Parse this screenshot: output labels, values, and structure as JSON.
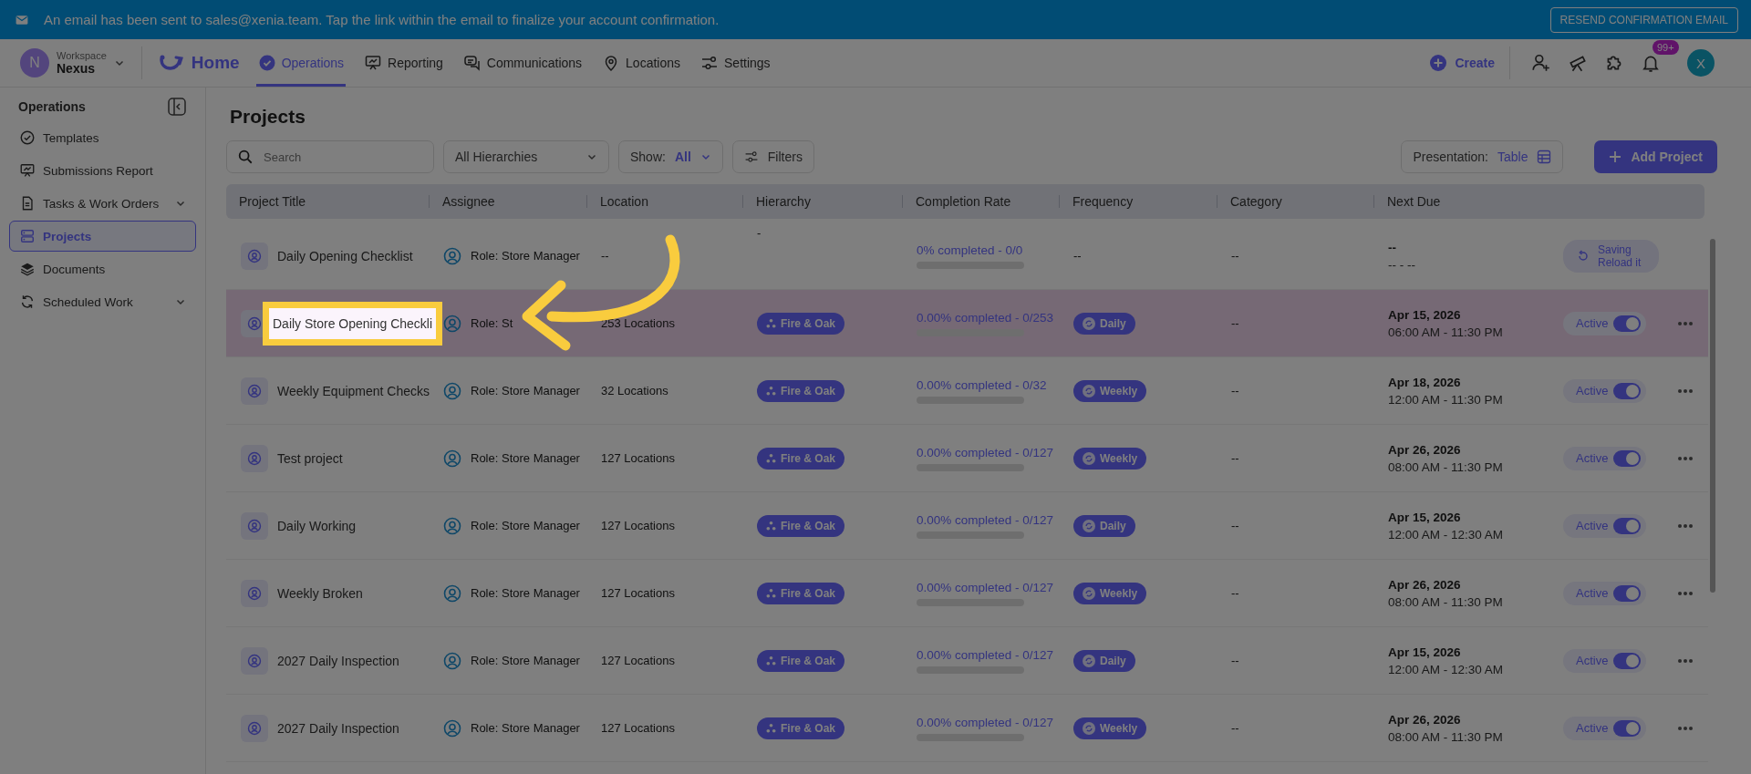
{
  "banner": {
    "message": "An email has been sent to sales@xenia.team. Tap the link within the email to finalize your account confirmation.",
    "button": "RESEND CONFIRMATION EMAIL"
  },
  "nav": {
    "workspace": {
      "initial": "N",
      "caption": "Workspace",
      "name": "Nexus"
    },
    "home": "Home",
    "tabs": [
      {
        "label": "Operations",
        "selected": true
      },
      {
        "label": "Reporting",
        "selected": false
      },
      {
        "label": "Communications",
        "selected": false
      },
      {
        "label": "Locations",
        "selected": false
      },
      {
        "label": "Settings",
        "selected": false
      }
    ],
    "create": "Create",
    "badge": "99+",
    "avatar": "X"
  },
  "sidebar": {
    "title": "Operations",
    "items": [
      {
        "label": "Templates",
        "expandable": false,
        "selected": false
      },
      {
        "label": "Submissions Report",
        "expandable": false,
        "selected": false
      },
      {
        "label": "Tasks & Work Orders",
        "expandable": true,
        "selected": false
      },
      {
        "label": "Projects",
        "expandable": false,
        "selected": true
      },
      {
        "label": "Documents",
        "expandable": false,
        "selected": false
      },
      {
        "label": "Scheduled Work",
        "expandable": true,
        "selected": false
      }
    ]
  },
  "page": {
    "title": "Projects",
    "search": {
      "placeholder": "Search"
    },
    "hierarchy_filter": "All Hierarchies",
    "show": {
      "label": "Show:",
      "value": "All"
    },
    "filters": "Filters",
    "presentation": {
      "label": "Presentation:",
      "value": "Table"
    },
    "add": "Add Project"
  },
  "table": {
    "columns": [
      "Project Title",
      "Assignee",
      "Location",
      "Hierarchy",
      "Completion Rate",
      "Frequency",
      "Category",
      "Next Due"
    ],
    "rows": [
      {
        "title": "Daily Opening Checklist",
        "spotlight": false,
        "highlighted": false,
        "assignee": "Role: Store Manager",
        "location": "--",
        "hierarchy": {
          "kind": "text",
          "label": "-"
        },
        "completion": "0% completed - 0/0",
        "level": 0,
        "frequency": {
          "kind": "text",
          "label": "--"
        },
        "category": "--",
        "due_date": "--",
        "due_time": "-- - --",
        "action": {
          "kind": "saving",
          "lines": [
            "Saving",
            "Reload it"
          ]
        }
      },
      {
        "title": "Daily Store Opening Checkli",
        "spotlight": true,
        "highlighted": true,
        "assignee": "Role: St",
        "location": "253 Locations",
        "hierarchy": {
          "kind": "tag",
          "label": "Fire & Oak"
        },
        "completion": "0.00% completed - 0/253",
        "level": 0,
        "frequency": {
          "kind": "tag",
          "label": "Daily"
        },
        "category": "--",
        "due_date": "Apr 15, 2026",
        "due_time": "06:00 AM - 11:30 PM",
        "action": {
          "kind": "toggle",
          "label": "Active",
          "on": true
        }
      },
      {
        "title": "Weekly Equipment Checks",
        "spotlight": false,
        "highlighted": false,
        "assignee": "Role: Store Manager",
        "location": "32 Locations",
        "hierarchy": {
          "kind": "tag",
          "label": "Fire & Oak"
        },
        "completion": "0.00% completed - 0/32",
        "level": 0,
        "frequency": {
          "kind": "tag",
          "label": "Weekly"
        },
        "category": "--",
        "due_date": "Apr 18, 2026",
        "due_time": "12:00 AM - 11:30 PM",
        "action": {
          "kind": "toggle",
          "label": "Active",
          "on": true
        }
      },
      {
        "title": "Test project",
        "spotlight": false,
        "highlighted": false,
        "assignee": "Role: Store Manager",
        "location": "127 Locations",
        "hierarchy": {
          "kind": "tag",
          "label": "Fire & Oak"
        },
        "completion": "0.00% completed - 0/127",
        "level": 0,
        "frequency": {
          "kind": "tag",
          "label": "Weekly"
        },
        "category": "--",
        "due_date": "Apr 26, 2026",
        "due_time": "08:00 AM - 11:30 PM",
        "action": {
          "kind": "toggle",
          "label": "Active",
          "on": true
        }
      },
      {
        "title": "Daily Working",
        "spotlight": false,
        "highlighted": false,
        "assignee": "Role: Store Manager",
        "location": "127 Locations",
        "hierarchy": {
          "kind": "tag",
          "label": "Fire & Oak"
        },
        "completion": "0.00% completed - 0/127",
        "level": 0,
        "frequency": {
          "kind": "tag",
          "label": "Daily"
        },
        "category": "--",
        "due_date": "Apr 15, 2026",
        "due_time": "12:00 AM - 12:30 AM",
        "action": {
          "kind": "toggle",
          "label": "Active",
          "on": true
        }
      },
      {
        "title": "Weekly Broken",
        "spotlight": false,
        "highlighted": false,
        "assignee": "Role: Store Manager",
        "location": "127 Locations",
        "hierarchy": {
          "kind": "tag",
          "label": "Fire & Oak"
        },
        "completion": "0.00% completed - 0/127",
        "level": 0,
        "frequency": {
          "kind": "tag",
          "label": "Weekly"
        },
        "category": "--",
        "due_date": "Apr 26, 2026",
        "due_time": "08:00 AM - 11:30 PM",
        "action": {
          "kind": "toggle",
          "label": "Active",
          "on": true
        }
      },
      {
        "title": "2027 Daily Inspection",
        "spotlight": false,
        "highlighted": false,
        "assignee": "Role: Store Manager",
        "location": "127 Locations",
        "hierarchy": {
          "kind": "tag",
          "label": "Fire & Oak"
        },
        "completion": "0.00% completed - 0/127",
        "level": 0,
        "frequency": {
          "kind": "tag",
          "label": "Daily"
        },
        "category": "--",
        "due_date": "Apr 15, 2026",
        "due_time": "12:00 AM - 12:30 AM",
        "action": {
          "kind": "toggle",
          "label": "Active",
          "on": true
        }
      },
      {
        "title": "2027 Daily Inspection",
        "spotlight": false,
        "highlighted": false,
        "assignee": "Role: Store Manager",
        "location": "127 Locations",
        "hierarchy": {
          "kind": "tag",
          "label": "Fire & Oak"
        },
        "completion": "0.00% completed - 0/127",
        "level": 0,
        "frequency": {
          "kind": "tag",
          "label": "Weekly"
        },
        "category": "--",
        "due_date": "Apr 26, 2026",
        "due_time": "08:00 AM - 11:30 PM",
        "action": {
          "kind": "toggle",
          "label": "Active",
          "on": true
        }
      }
    ]
  }
}
